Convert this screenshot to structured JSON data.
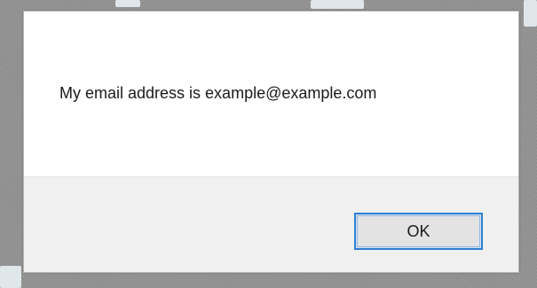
{
  "dialog": {
    "message": "My email address is example@example.com",
    "ok_label": "OK"
  }
}
